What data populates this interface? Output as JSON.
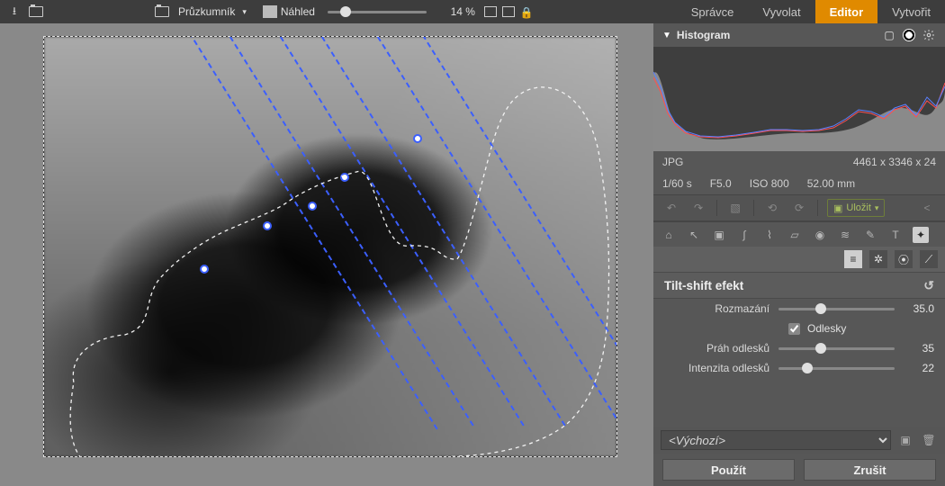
{
  "topbar": {
    "explorer_label": "Průzkumník",
    "preview_label": "Náhled",
    "zoom_percent": "14 %"
  },
  "main_tabs": [
    {
      "label": "Správce"
    },
    {
      "label": "Vyvolat"
    },
    {
      "label": "Editor"
    },
    {
      "label": "Vytvořit"
    }
  ],
  "histogram": {
    "title": "Histogram"
  },
  "meta": {
    "format": "JPG",
    "dimensions": "4461 x 3346 x 24",
    "shutter": "1/60 s",
    "aperture": "F5.0",
    "iso": "ISO 800",
    "focal": "52.00 mm"
  },
  "save_label": "Uložit",
  "tilt_shift": {
    "title": "Tilt-shift efekt",
    "blur_label": "Rozmazání",
    "blur_value": "35.0",
    "specular_label": "Odlesky",
    "specular_checked": true,
    "threshold_label": "Práh odlesků",
    "threshold_value": "35",
    "intensity_label": "Intenzita odlesků",
    "intensity_value": "22"
  },
  "preset": {
    "default": "<Výchozí>"
  },
  "buttons": {
    "apply": "Použít",
    "cancel": "Zrušit"
  }
}
